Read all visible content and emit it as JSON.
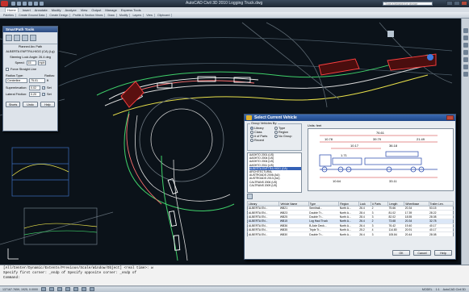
{
  "window": {
    "title": "AutoCAD Civil 3D 2010   Logging Truck.dwg",
    "search_placeholder": "Type a keyword or phrase"
  },
  "menubar": {
    "items": [
      "Home",
      "Insert",
      "Annotate",
      "Modify",
      "Analyze",
      "View",
      "Output",
      "Manage",
      "Express Tools"
    ],
    "active": "Home"
  },
  "ribbon": {
    "items": [
      "Palettes",
      "Create Ground Data",
      "Create Design",
      "Profile & Section Views",
      "Draw",
      "Modify",
      "Layers",
      "View",
      "Clipboard"
    ]
  },
  "smartpath": {
    "title": "SmartPath Tools",
    "mode": "Planned Arc Path",
    "vehicle": "ALBERTA ENFTR4-HIGG (CA) (Lg)",
    "steering": "Steering Lock Angle: 26.4 deg",
    "speed_label": "Speed:",
    "speed_value": "15",
    "speed_unit": "mph",
    "force_straight": "Force Straight Line",
    "radius_type_label": "Radius Type:",
    "radius_label": "Radius:",
    "radius_type_value": "Centerline",
    "radius_value": "75.01",
    "radius_unit": "ft",
    "superelevation_label": "Superelevation:",
    "superelevation_value": "0.02",
    "lateral_label": "Lateral Friction:",
    "lateral_value": "0.20",
    "set_label": "Set",
    "buttons": {
      "shorts": "Shorts",
      "undo": "Undo",
      "help": "Help"
    }
  },
  "dialog": {
    "title": "Select Current Vehicle",
    "group_label": "Group Vehicles By:",
    "radios": [
      {
        "label": "Library",
        "on": true
      },
      {
        "label": "Type",
        "on": false
      },
      {
        "label": "Class",
        "on": false
      },
      {
        "label": "Region",
        "on": false
      },
      {
        "label": "# of Parts",
        "on": false
      },
      {
        "label": "No Group",
        "on": false
      },
      {
        "label": "Recent",
        "on": false
      }
    ],
    "tree": [
      {
        "text": "AASHTO 2001 (US)",
        "sel": false
      },
      {
        "text": "AASHTO 2004 (US)",
        "sel": false
      },
      {
        "text": "AASHTO 2004 (US)",
        "sel": false
      },
      {
        "text": "AASHTO 2011 (US)",
        "sel": false
      },
      {
        "text": "ALBERTA ENFTR4-HIGG (CA)",
        "sel": true
      },
      {
        "text": "ARCHITECTURAL",
        "sel": false
      },
      {
        "text": "AUSTROADS 2006 (AU)",
        "sel": false
      },
      {
        "text": "AUSTROADS 2013 (AU)",
        "sel": false
      },
      {
        "text": "CALTRANS 2006 (US)",
        "sel": false
      },
      {
        "text": "CALTRANS 2009 (US)",
        "sel": false
      }
    ],
    "units_label": "Units: feet",
    "preview_dims": {
      "d1": "10.78",
      "d2": "76.61",
      "d3": "39.79",
      "d4": "36.18",
      "d5": "21.49",
      "d6": "10.17",
      "d7": "1.71",
      "d8": "10.64",
      "d9": "33.11"
    },
    "table_headers": [
      "Library",
      "Vehicle Name",
      "Type",
      "Region",
      "Lock",
      "# Parts",
      "Length",
      "Wheelbase",
      "Trailer Len."
    ],
    "rows": [
      {
        "cells": [
          "ALBERTA EN...",
          "WB21",
          "Semitrail...",
          "North A...",
          "26.4",
          "2",
          "75.66",
          "20.34",
          "53.15"
        ],
        "sel": false
      },
      {
        "cells": [
          "ALBERTA EN...",
          "WB23",
          "Double Tr...",
          "North A...",
          "28.4",
          "3",
          "81.02",
          "17.39",
          "28.22"
        ],
        "sel": false
      },
      {
        "cells": [
          "ALBERTA EN...",
          "WB25",
          "Double Tr...",
          "North A...",
          "28.4",
          "3",
          "82.02",
          "18.55",
          "28.08"
        ],
        "sel": false
      },
      {
        "cells": [
          "ALBERTA EN...",
          "WB15",
          "Log Haul Truck",
          "North A...",
          "26.4",
          "2",
          "73.68",
          "20.34",
          "32.78"
        ],
        "sel": true
      },
      {
        "cells": [
          "ALBERTA EN...",
          "WB36",
          "B-Axle Deck...",
          "North A...",
          "26.4",
          "3",
          "76.42",
          "19.40",
          "40.17"
        ],
        "sel": false
      },
      {
        "cells": [
          "ALBERTA EN...",
          "WB35",
          "Triple Tr...",
          "North A...",
          "25.2",
          "4",
          "114.80",
          "20.91",
          "40.17"
        ],
        "sel": false
      },
      {
        "cells": [
          "ALBERTA EN...",
          "WB30",
          "Double Tr...",
          "North A...",
          "26.4",
          "3",
          "105.84",
          "20.44",
          "28.08"
        ],
        "sel": false
      }
    ],
    "buttons": {
      "ok": "OK",
      "cancel": "Cancel",
      "help": "Help"
    }
  },
  "command": {
    "lines": [
      "[All/Center/Dynamic/Extents/Previous/Scale/Window/Object] <real time>: w",
      "Specify first corner: _endp of Specify opposite corner: _endp of",
      "Command:"
    ]
  },
  "status": {
    "coords": "137167.7659, 1925, 0.0000",
    "right": [
      "MODEL",
      "1:1",
      "AutoCAD Civil 3D"
    ]
  }
}
